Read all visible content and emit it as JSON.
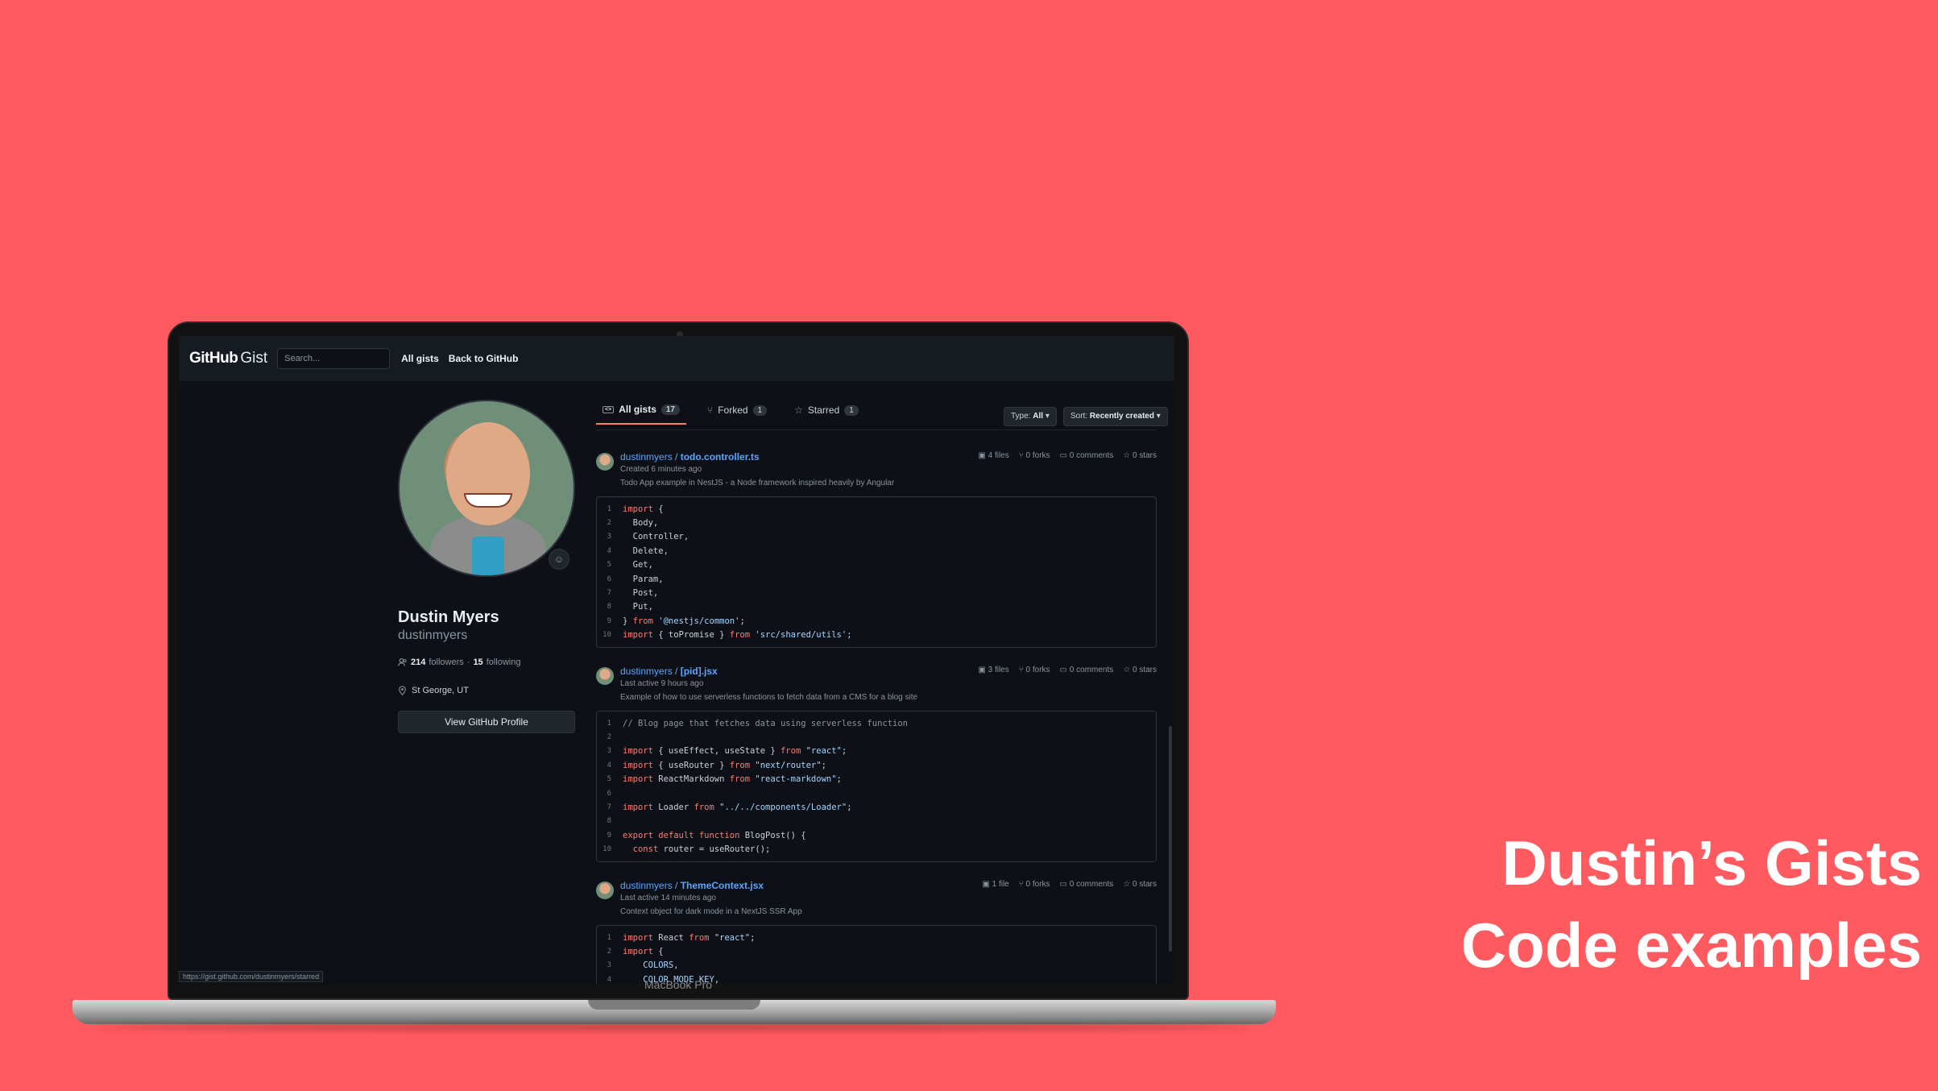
{
  "header": {
    "logo_bold": "GitHub",
    "logo_light": "Gist",
    "search_placeholder": "Search...",
    "nav": [
      "All gists",
      "Back to GitHub"
    ]
  },
  "profile": {
    "name": "Dustin Myers",
    "login": "dustinmyers",
    "followers": "214",
    "followers_label": "followers",
    "following": "15",
    "following_label": "following",
    "location": "St George, UT",
    "button": "View GitHub Profile"
  },
  "tabs": [
    {
      "label": "All gists",
      "count": "17"
    },
    {
      "label": "Forked",
      "count": "1"
    },
    {
      "label": "Starred",
      "count": "1"
    }
  ],
  "filters": {
    "type_label": "Type:",
    "type_value": "All",
    "sort_label": "Sort:",
    "sort_value": "Recently created"
  },
  "gists": [
    {
      "owner": "dustinmyers",
      "file": "todo.controller.ts",
      "meta": "Created 6 minutes ago",
      "description": "Todo App example in NestJS - a Node framework inspired heavily by Angular",
      "files": "4 files",
      "forks": "0 forks",
      "comments": "0 comments",
      "stars": "0 stars"
    },
    {
      "owner": "dustinmyers",
      "file": "[pid].jsx",
      "meta": "Last active 9 hours ago",
      "description": "Example of how to use serverless functions to fetch data from a CMS for a blog site",
      "files": "3 files",
      "forks": "0 forks",
      "comments": "0 comments",
      "stars": "0 stars"
    },
    {
      "owner": "dustinmyers",
      "file": "ThemeContext.jsx",
      "meta": "Last active 14 minutes ago",
      "description": "Context object for dark mode in a NextJS SSR App",
      "files": "1 file",
      "forks": "0 forks",
      "comments": "0 comments",
      "stars": "0 stars"
    }
  ],
  "status_url": "https://gist.github.com/dustinmyers/starred",
  "laptop_label": "MacBook Pro",
  "caption": {
    "line1": "Dustin’s Gists",
    "line2": "Code examples"
  },
  "colors": {
    "background": "#FF5A5F",
    "link": "#58a6ff",
    "tab_underline": "#f78166"
  }
}
